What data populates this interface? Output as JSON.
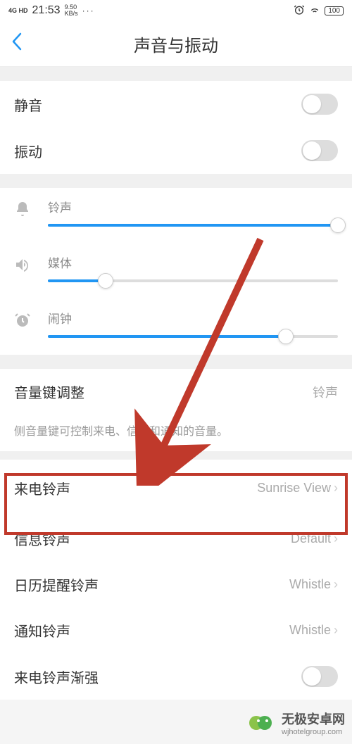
{
  "status": {
    "network": "4G HD",
    "time": "21:53",
    "speed_top": "9.50",
    "speed_bottom": "KB/s",
    "dots": "···",
    "battery": "100"
  },
  "header": {
    "title": "声音与振动"
  },
  "toggles": {
    "mute": {
      "label": "静音"
    },
    "vibrate": {
      "label": "振动"
    },
    "fade_in": {
      "label": "来电铃声渐强"
    }
  },
  "sliders": {
    "ringtone": {
      "label": "铃声",
      "value": 100
    },
    "media": {
      "label": "媒体",
      "value": 20
    },
    "alarm": {
      "label": "闹钟",
      "value": 82
    }
  },
  "volume_key": {
    "label": "音量键调整",
    "value": "铃声",
    "hint": "侧音量键可控制来电、信息和通知的音量。"
  },
  "ringtones": {
    "incoming": {
      "label": "来电铃声",
      "value": "Sunrise View"
    },
    "message": {
      "label": "信息铃声",
      "value": "Default"
    },
    "calendar": {
      "label": "日历提醒铃声",
      "value": "Whistle"
    },
    "notification": {
      "label": "通知铃声",
      "value": "Whistle"
    }
  },
  "watermark": {
    "cn": "无极安卓网",
    "en": "wjhotelgroup.com"
  }
}
